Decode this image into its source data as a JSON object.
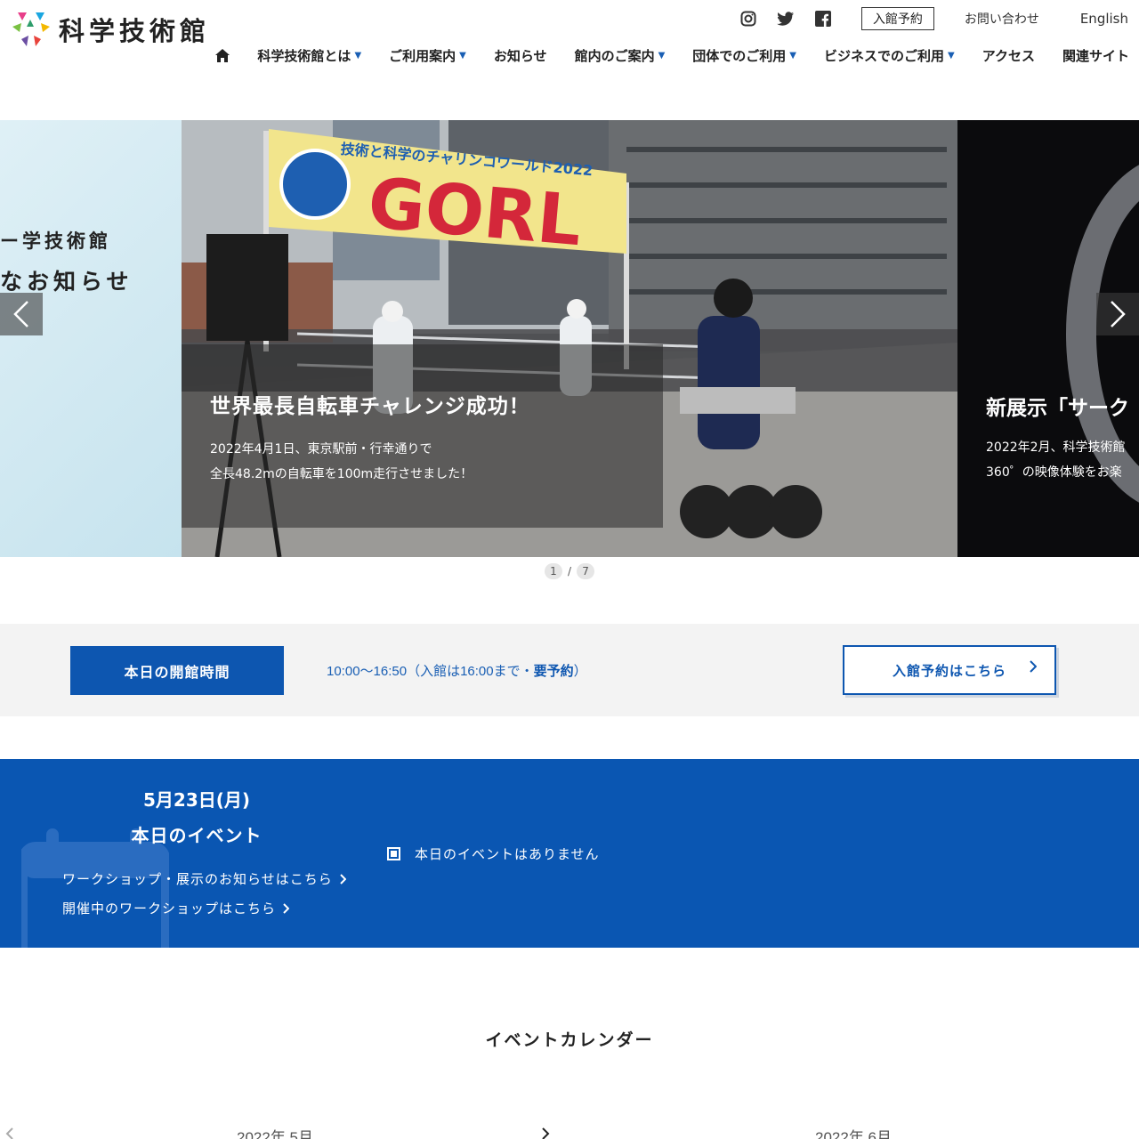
{
  "header": {
    "logo_text": "科学技術館",
    "sns": [
      "instagram-icon",
      "twitter-icon",
      "facebook-icon"
    ],
    "reserve_label": "入館予約",
    "contact_label": "お問い合わせ",
    "english_label": "English"
  },
  "nav": {
    "items": [
      {
        "label": "科学技術館とは",
        "caret": "▼"
      },
      {
        "label": "ご利用案内",
        "caret": "▼"
      },
      {
        "label": "お知らせ",
        "caret": ""
      },
      {
        "label": "館内のご案内",
        "caret": "▼"
      },
      {
        "label": "団体でのご利用",
        "caret": "▼"
      },
      {
        "label": "ビジネスでのご利用",
        "caret": "▼"
      },
      {
        "label": "アクセス",
        "caret": ""
      },
      {
        "label": "関連サイト",
        "caret": ""
      }
    ]
  },
  "slider": {
    "left_slide": {
      "line1": "ー学技術館",
      "line2": "なお知らせ"
    },
    "main_slide": {
      "banner_small": "技術と科学のチャリンコワールド2022",
      "banner_big": "GORL",
      "title": "世界最長自転車チャレンジ成功！",
      "line1": "2022年4月1日、東京駅前・行幸通りで",
      "line2": "全長48.2mの自転車を100m走行させました！"
    },
    "right_slide": {
      "title": "新展示「サーク",
      "line1": "2022年2月、科学技術館",
      "line2": "360゜の映像体験をお楽"
    },
    "pager": {
      "current": "1",
      "separator": "/",
      "total": "7"
    }
  },
  "hours": {
    "label": "本日の開館時間",
    "time": "10:00〜16:50（入館は16:00まで・",
    "time_emph": "要予約",
    "time_end": "）",
    "reserve_button": "入館予約はこちら"
  },
  "today": {
    "date": "5月23日(月)",
    "heading": "本日のイベント",
    "link1": "ワークショップ・展示のお知らせはこちら",
    "link2": "開催中のワークショップはこちら",
    "no_events": "本日のイベントはありません"
  },
  "calendar": {
    "title": "イベントカレンダー",
    "month_left": "2022年 5月",
    "month_right": "2022年 6月"
  },
  "colors": {
    "primary": "#0a56b2",
    "accent": "#1a5fb4"
  }
}
